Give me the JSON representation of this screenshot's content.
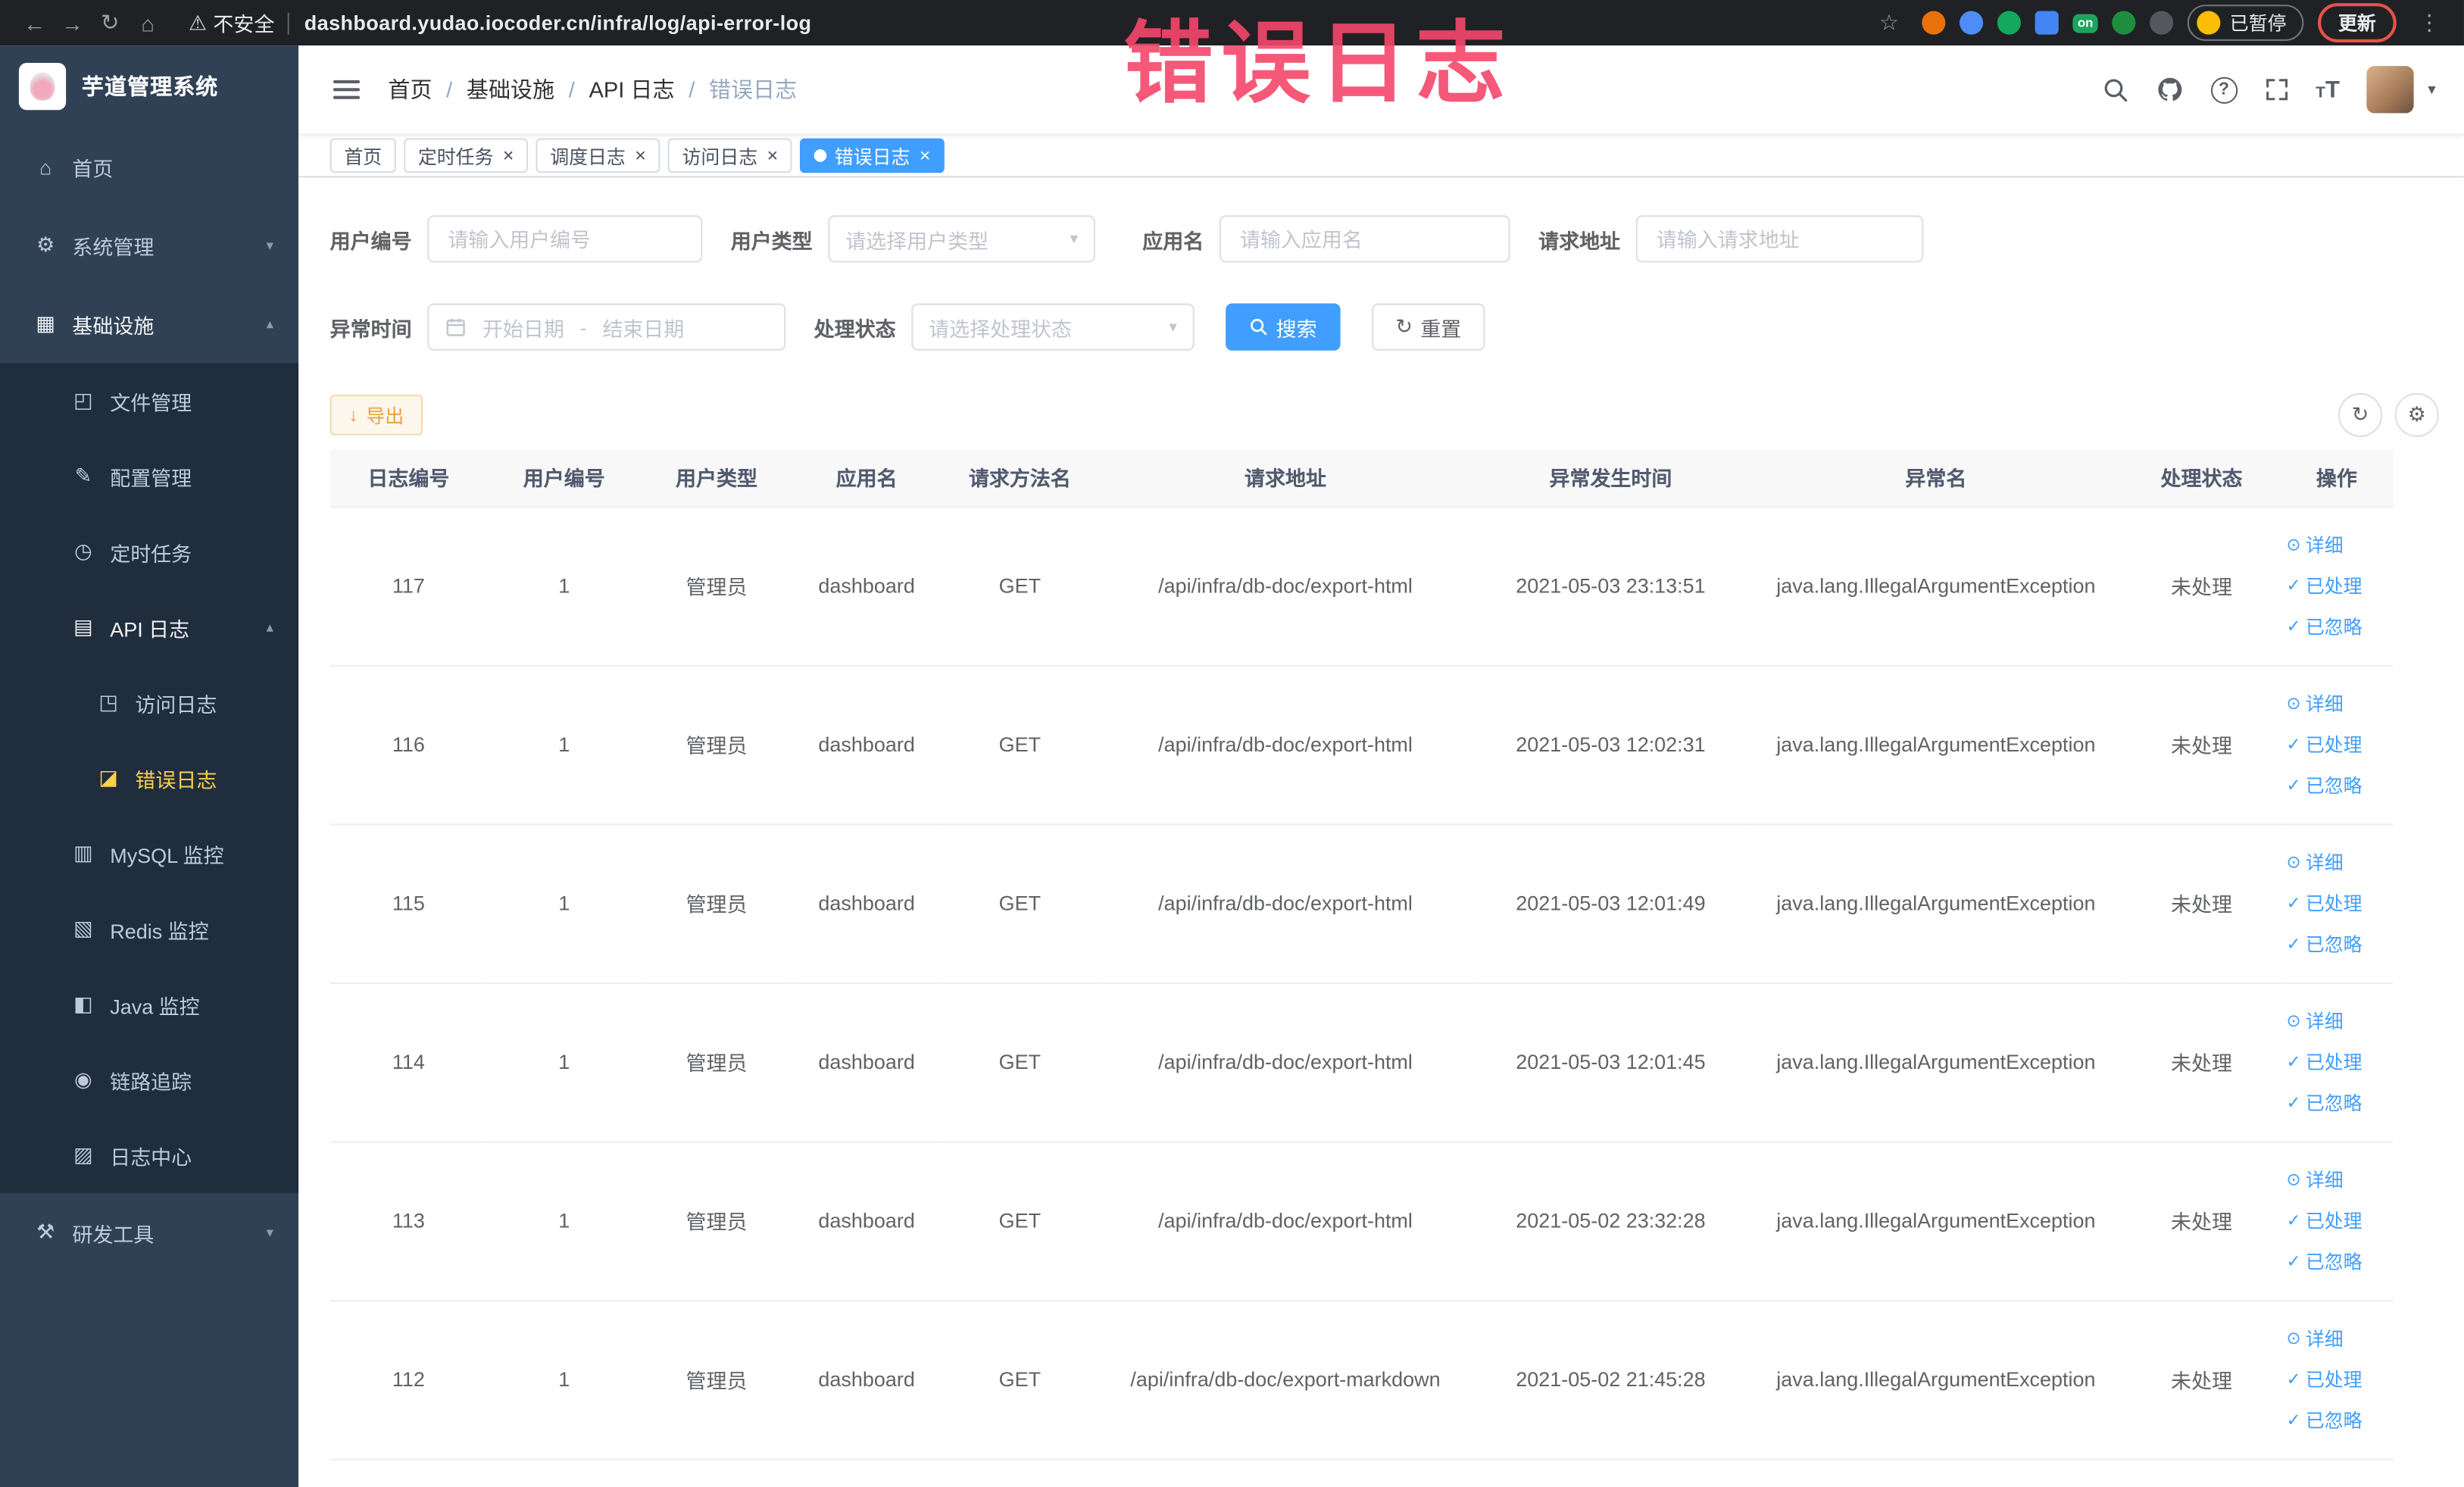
{
  "colors": {
    "primary": "#409eff",
    "sidebar_bg": "#304156",
    "submenu_bg": "#1f2d3d",
    "active_menu": "#ffd04b",
    "warning": "#e6a23c",
    "annotation": "#f5476b"
  },
  "browser": {
    "security_label": "不安全",
    "url": "dashboard.yudao.iocoder.cn/infra/log/api-error-log",
    "paused_badge": "已暂停",
    "update_button": "更新",
    "on_badge": "on"
  },
  "overlay_text": "错误日志",
  "icons": {
    "back": "←",
    "forward": "→",
    "reload": "↻",
    "home": "⌂",
    "warning": "⚠",
    "star": "☆",
    "kebab": "⋮",
    "close": "×",
    "caret": "▾",
    "refresh": "↻",
    "settings": "⚙",
    "download": "↓",
    "eye": "⊙",
    "check": "✓",
    "range_sep": "-",
    "question": "?",
    "font_small": "T",
    "font_large": "T"
  },
  "sidebar": {
    "logo_title": "芋道管理系统",
    "items": [
      {
        "name": "home",
        "label": "首页",
        "glyph": "⌂",
        "icon": "home-icon",
        "level": 0
      },
      {
        "name": "system-management",
        "label": "系统管理",
        "glyph": "⚙",
        "icon": "gear-icon",
        "level": 0,
        "chevron": "▾"
      },
      {
        "name": "infrastructure",
        "label": "基础设施",
        "glyph": "▦",
        "icon": "infrastructure-icon",
        "level": 0,
        "chevron": "▴",
        "open": true
      },
      {
        "name": "file-management",
        "label": "文件管理",
        "glyph": "◰",
        "icon": "file-icon",
        "level": 1
      },
      {
        "name": "config-management",
        "label": "配置管理",
        "glyph": "✎",
        "icon": "config-icon",
        "level": 1
      },
      {
        "name": "scheduled-tasks",
        "label": "定时任务",
        "glyph": "◷",
        "icon": "timer-icon",
        "level": 1
      },
      {
        "name": "api-logs",
        "label": "API 日志",
        "glyph": "▤",
        "icon": "api-log-icon",
        "level": 1,
        "chevron": "▴",
        "open": true
      },
      {
        "name": "access-logs",
        "label": "访问日志",
        "glyph": "◳",
        "icon": "access-log-icon",
        "level": 2
      },
      {
        "name": "error-logs",
        "label": "错误日志",
        "glyph": "◪",
        "icon": "error-log-icon",
        "level": 2,
        "active": true
      },
      {
        "name": "mysql-monitor",
        "label": "MySQL 监控",
        "glyph": "▥",
        "icon": "mysql-icon",
        "level": 1
      },
      {
        "name": "redis-monitor",
        "label": "Redis 监控",
        "glyph": "▧",
        "icon": "redis-icon",
        "level": 1
      },
      {
        "name": "java-monitor",
        "label": "Java 监控",
        "glyph": "◧",
        "icon": "java-icon",
        "level": 1
      },
      {
        "name": "trace",
        "label": "链路追踪",
        "glyph": "◉",
        "icon": "trace-icon",
        "level": 1
      },
      {
        "name": "log-center",
        "label": "日志中心",
        "glyph": "▨",
        "icon": "log-center-icon",
        "level": 1
      },
      {
        "name": "dev-tools",
        "label": "研发工具",
        "glyph": "⚒",
        "icon": "dev-tools-icon",
        "level": 0,
        "chevron": "▾"
      }
    ]
  },
  "header": {
    "breadcrumb": [
      "首页",
      "基础设施",
      "API 日志",
      "错误日志"
    ],
    "breadcrumb_separator": "/"
  },
  "tabs": [
    {
      "label": "首页",
      "closable": false,
      "active": false
    },
    {
      "label": "定时任务",
      "closable": true,
      "active": false
    },
    {
      "label": "调度日志",
      "closable": true,
      "active": false
    },
    {
      "label": "访问日志",
      "closable": true,
      "active": false
    },
    {
      "label": "错误日志",
      "closable": true,
      "active": true
    }
  ],
  "filters": {
    "user_id_label": "用户编号",
    "user_id_placeholder": "请输入用户编号",
    "user_type_label": "用户类型",
    "user_type_placeholder": "请选择用户类型",
    "app_name_label": "应用名",
    "app_name_placeholder": "请输入应用名",
    "request_url_label": "请求地址",
    "request_url_placeholder": "请输入请求地址",
    "exception_time_label": "异常时间",
    "start_date_placeholder": "开始日期",
    "end_date_placeholder": "结束日期",
    "process_status_label": "处理状态",
    "process_status_placeholder": "请选择处理状态",
    "search_button": "搜索",
    "reset_button": "重置"
  },
  "toolbar": {
    "export_button": "导出"
  },
  "table": {
    "columns": [
      "日志编号",
      "用户编号",
      "用户类型",
      "应用名",
      "请求方法名",
      "请求地址",
      "异常发生时间",
      "异常名",
      "处理状态",
      "操作"
    ],
    "actions": [
      "详细",
      "已处理",
      "已忽略"
    ],
    "rows": [
      {
        "id": "117",
        "user_id": "1",
        "user_type": "管理员",
        "app": "dashboard",
        "method": "GET",
        "url": "/api/infra/db-doc/export-html",
        "time": "2021-05-03 23:13:51",
        "exception": "java.lang.IllegalArgumentException",
        "status": "未处理"
      },
      {
        "id": "116",
        "user_id": "1",
        "user_type": "管理员",
        "app": "dashboard",
        "method": "GET",
        "url": "/api/infra/db-doc/export-html",
        "time": "2021-05-03 12:02:31",
        "exception": "java.lang.IllegalArgumentException",
        "status": "未处理"
      },
      {
        "id": "115",
        "user_id": "1",
        "user_type": "管理员",
        "app": "dashboard",
        "method": "GET",
        "url": "/api/infra/db-doc/export-html",
        "time": "2021-05-03 12:01:49",
        "exception": "java.lang.IllegalArgumentException",
        "status": "未处理"
      },
      {
        "id": "114",
        "user_id": "1",
        "user_type": "管理员",
        "app": "dashboard",
        "method": "GET",
        "url": "/api/infra/db-doc/export-html",
        "time": "2021-05-03 12:01:45",
        "exception": "java.lang.IllegalArgumentException",
        "status": "未处理"
      },
      {
        "id": "113",
        "user_id": "1",
        "user_type": "管理员",
        "app": "dashboard",
        "method": "GET",
        "url": "/api/infra/db-doc/export-html",
        "time": "2021-05-02 23:32:28",
        "exception": "java.lang.IllegalArgumentException",
        "status": "未处理"
      },
      {
        "id": "112",
        "user_id": "1",
        "user_type": "管理员",
        "app": "dashboard",
        "method": "GET",
        "url": "/api/infra/db-doc/export-markdown",
        "time": "2021-05-02 21:45:28",
        "exception": "java.lang.IllegalArgumentException",
        "status": "未处理"
      }
    ]
  }
}
